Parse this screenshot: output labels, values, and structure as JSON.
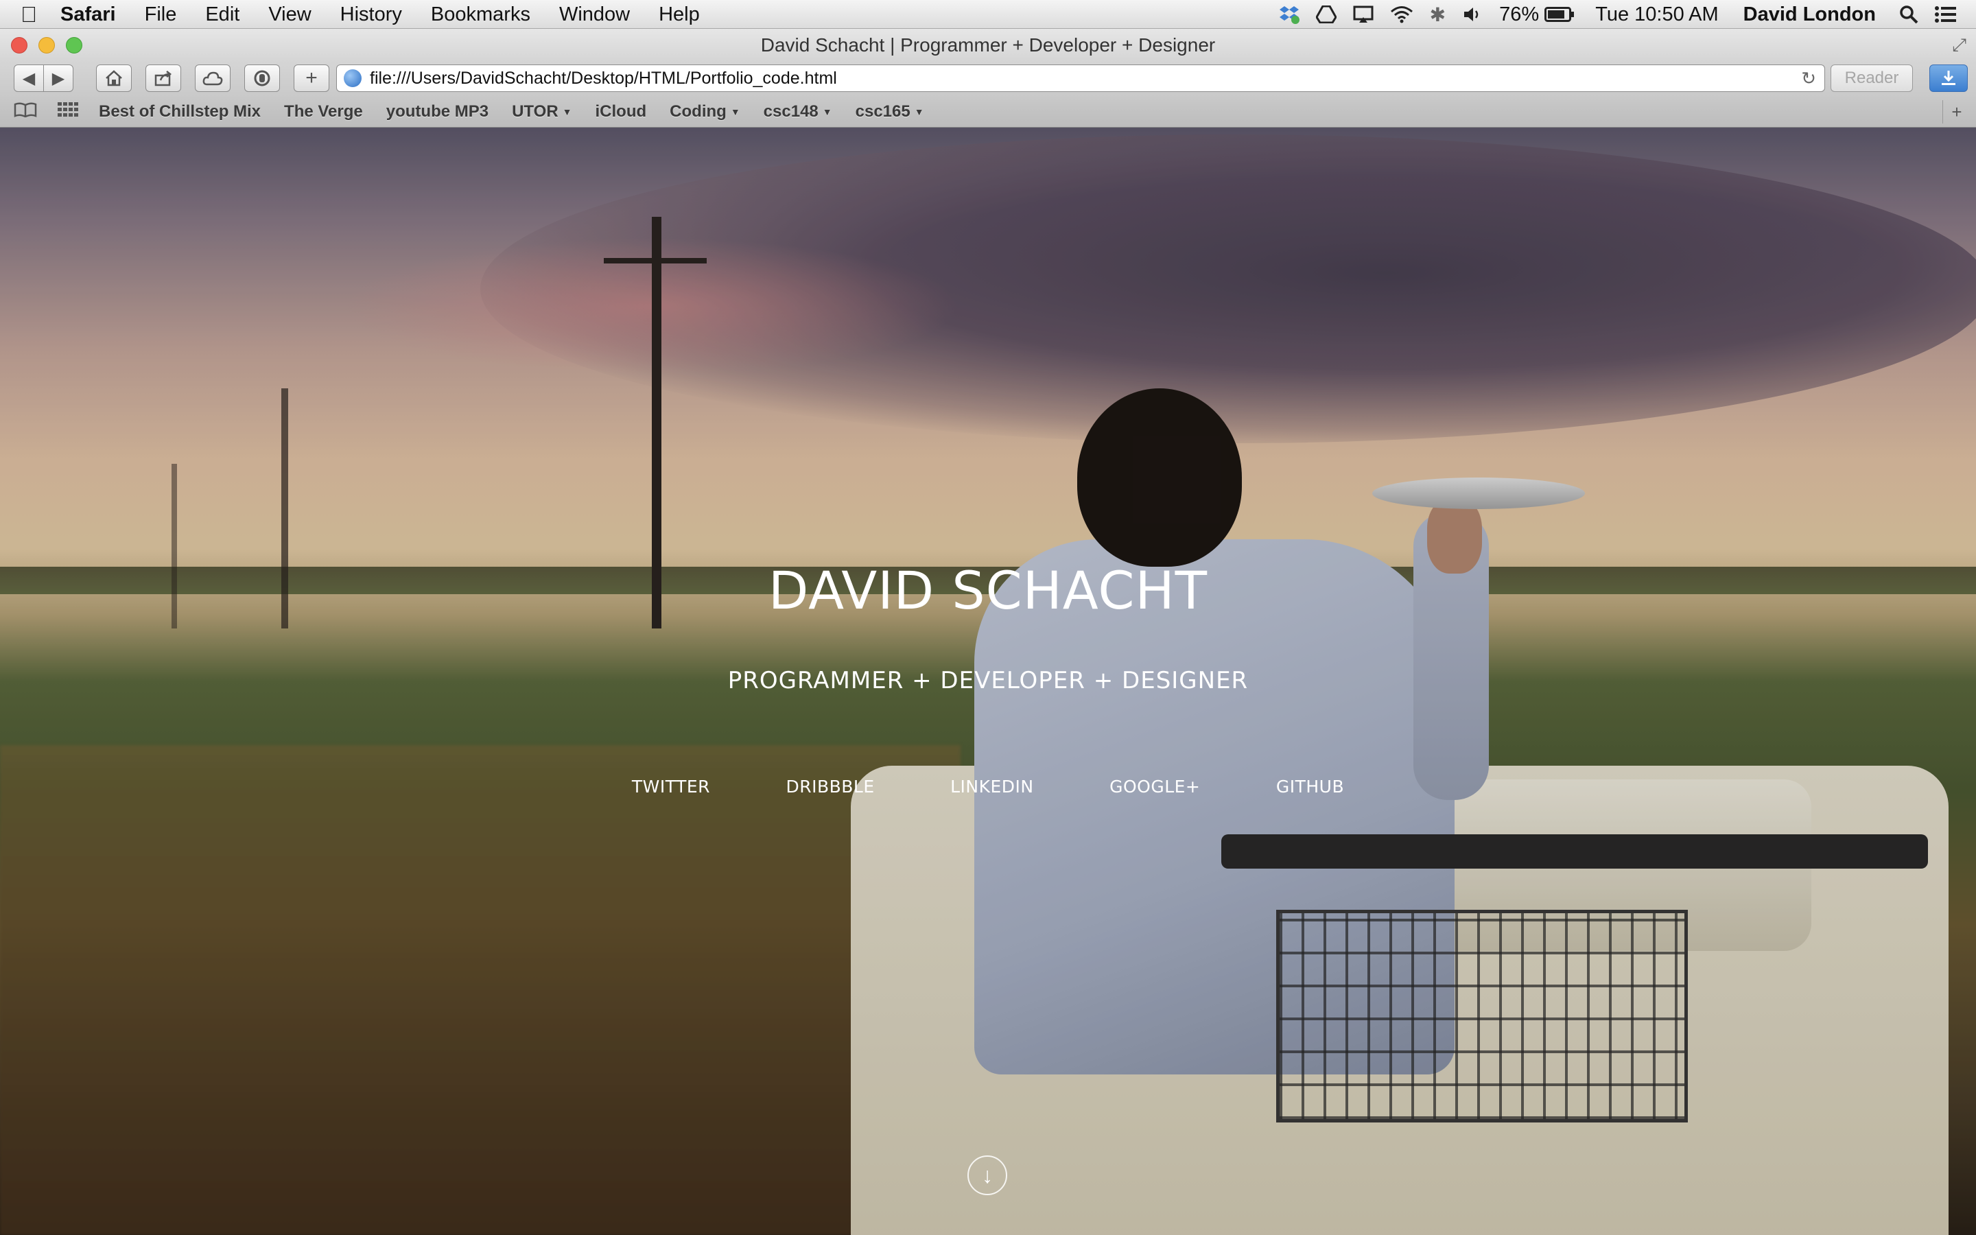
{
  "menubar": {
    "apple": "",
    "app_name": "Safari",
    "items": [
      "File",
      "Edit",
      "View",
      "History",
      "Bookmarks",
      "Window",
      "Help"
    ],
    "battery": "76%",
    "clock": "Tue 10:50 AM",
    "user": "David London"
  },
  "window": {
    "title": "David Schacht | Programmer + Developer + Designer",
    "url": "file:///Users/DavidSchacht/Desktop/HTML/Portfolio_code.html",
    "reader_label": "Reader"
  },
  "bookmarks": [
    {
      "label": "Best of Chillstep Mix",
      "dropdown": false
    },
    {
      "label": "The Verge",
      "dropdown": false
    },
    {
      "label": "youtube MP3",
      "dropdown": false
    },
    {
      "label": "UTOR",
      "dropdown": true
    },
    {
      "label": "iCloud",
      "dropdown": false
    },
    {
      "label": "Coding",
      "dropdown": true
    },
    {
      "label": "csc148",
      "dropdown": true
    },
    {
      "label": "csc165",
      "dropdown": true
    }
  ],
  "hero": {
    "title": "DAVID SCHACHT",
    "subtitle": "PROGRAMMER + DEVELOPER + DESIGNER",
    "links": [
      "TWITTER",
      "DRIBBBLE",
      "LINKEDIN",
      "GOOGLE+",
      "GITHUB"
    ]
  },
  "colors": {
    "text": "#ffffff",
    "close": "#ee5a50",
    "minimize": "#f5bc3b",
    "maximize": "#5fc552"
  }
}
